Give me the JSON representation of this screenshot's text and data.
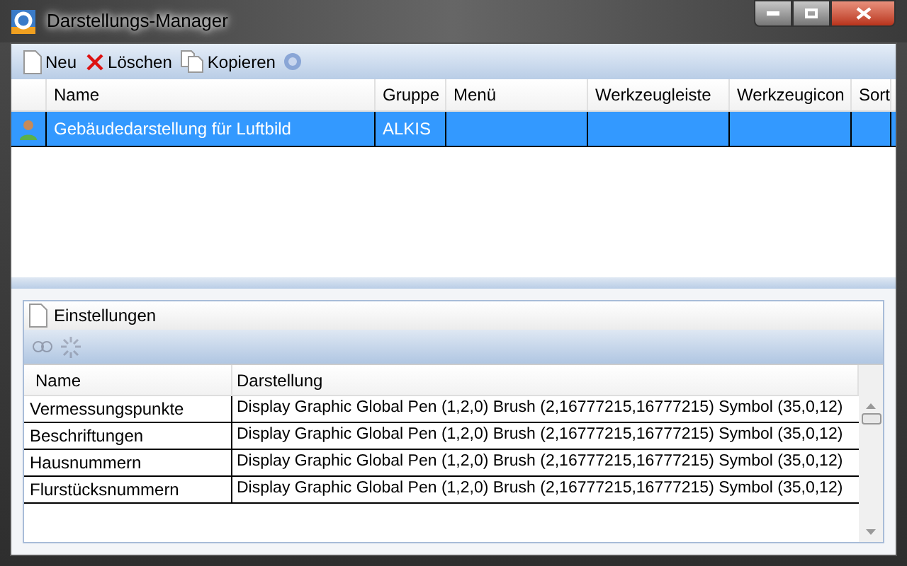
{
  "window": {
    "title": "Darstellungs-Manager"
  },
  "toolbar": [
    {
      "kind": "new",
      "label": "Neu"
    },
    {
      "kind": "delete",
      "label": "Löschen"
    },
    {
      "kind": "copy",
      "label": "Kopieren"
    },
    {
      "kind": "help"
    }
  ],
  "table": {
    "columns": [
      "Name",
      "Gruppe",
      "Menü",
      "Werkzeugleiste",
      "Werkzeugicon",
      "Sort"
    ],
    "rows": [
      {
        "selected": true,
        "cells": [
          "Gebäudedarstellung für Luftbild",
          "ALKIS",
          "",
          "",
          "",
          ""
        ]
      }
    ]
  },
  "settings": {
    "title": "Einstellungen",
    "tools": [
      {
        "kind": "link",
        "disabled": true
      },
      {
        "kind": "unlink",
        "disabled": true
      }
    ],
    "columns": [
      "Name",
      "Darstellung"
    ],
    "rows": [
      [
        "Vermessungspunkte",
        "Display Graphic Global Pen (1,2,0) Brush (2,16777215,16777215) Symbol (35,0,12)"
      ],
      [
        "Beschriftungen",
        "Display Graphic Global Pen (1,2,0) Brush (2,16777215,16777215) Symbol (35,0,12)"
      ],
      [
        "Hausnummern",
        "Display Graphic Global Pen (1,2,0) Brush (2,16777215,16777215) Symbol (35,0,12)"
      ],
      [
        "Flurstücksnummern",
        "Display Graphic Global Pen (1,2,0) Brush (2,16777215,16777215) Symbol (35,0,12)"
      ]
    ]
  }
}
